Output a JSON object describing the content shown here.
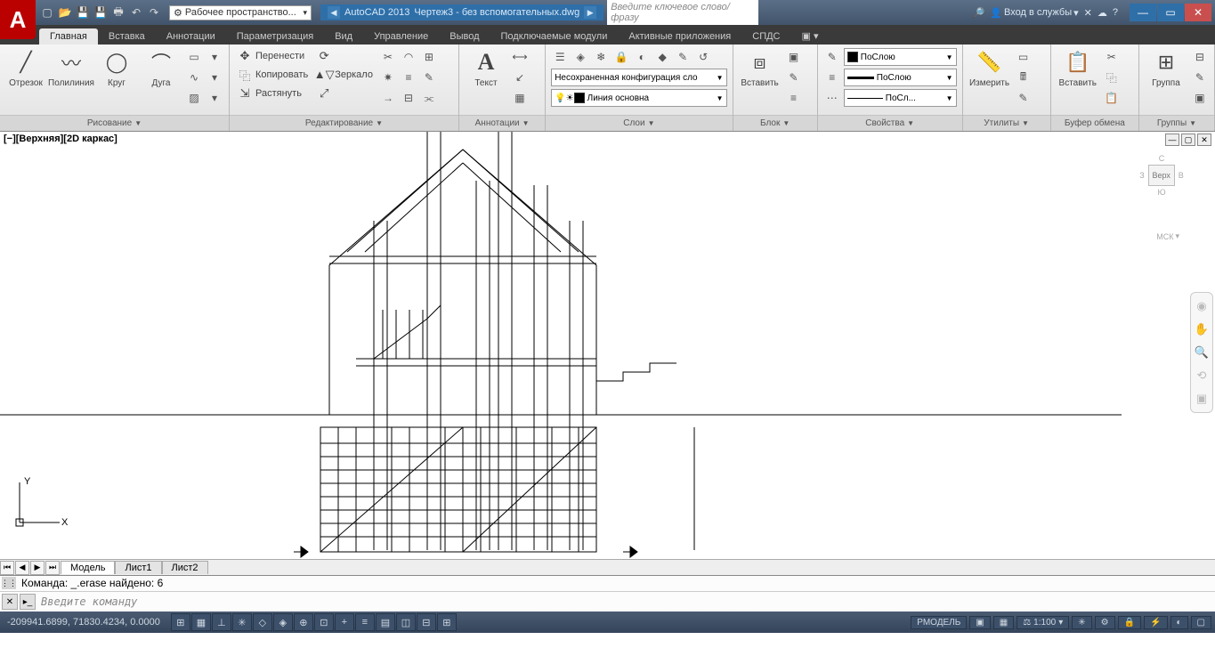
{
  "titlebar": {
    "workspace": "Рабочее пространство...",
    "app_name": "AutoCAD 2013",
    "doc_name": "Чертеж3 - без вспомогательных.dwg",
    "search_placeholder": "Введите ключевое слово/фразу",
    "signin": "Вход в службы"
  },
  "tabs": [
    "Главная",
    "Вставка",
    "Аннотации",
    "Параметризация",
    "Вид",
    "Управление",
    "Вывод",
    "Подключаемые модули",
    "Активные приложения",
    "СПДС"
  ],
  "ribbon": {
    "draw": {
      "title": "Рисование",
      "line": "Отрезок",
      "pline": "Полилиния",
      "circle": "Круг",
      "arc": "Дуга"
    },
    "modify": {
      "title": "Редактирование",
      "move": "Перенести",
      "copy": "Копировать",
      "stretch": "Растянуть",
      "mirror": "Зеркало"
    },
    "annot": {
      "title": "Аннотации",
      "text": "Текст"
    },
    "layers": {
      "title": "Слои",
      "unsaved": "Несохраненная конфигурация сло",
      "linetype": "Линия основна"
    },
    "block": {
      "title": "Блок",
      "insert": "Вставить"
    },
    "props": {
      "title": "Свойства",
      "bylayer": "ПоСлою",
      "bylayer2": "ПоСлою",
      "bylayer3": "ПоСл..."
    },
    "utils": {
      "title": "Утилиты",
      "measure": "Измерить"
    },
    "clip": {
      "title": "Буфер обмена",
      "paste": "Вставить"
    },
    "groups": {
      "title": "Группы",
      "group": "Группа"
    }
  },
  "viewport": {
    "label": "[−][Верхняя][2D каркас]",
    "cube": {
      "n": "С",
      "s": "Ю",
      "w": "З",
      "e": "В",
      "top": "Верх"
    },
    "wcs": "МСК"
  },
  "layouts": {
    "model": "Модель",
    "l1": "Лист1",
    "l2": "Лист2"
  },
  "cmd": {
    "history": "Команда: _.erase найдено: 6",
    "prompt": "Введите команду"
  },
  "status": {
    "coords": "-209941.6899, 71830.4234, 0.0000",
    "model": "РМОДЕЛЬ",
    "scale": "1:100"
  }
}
